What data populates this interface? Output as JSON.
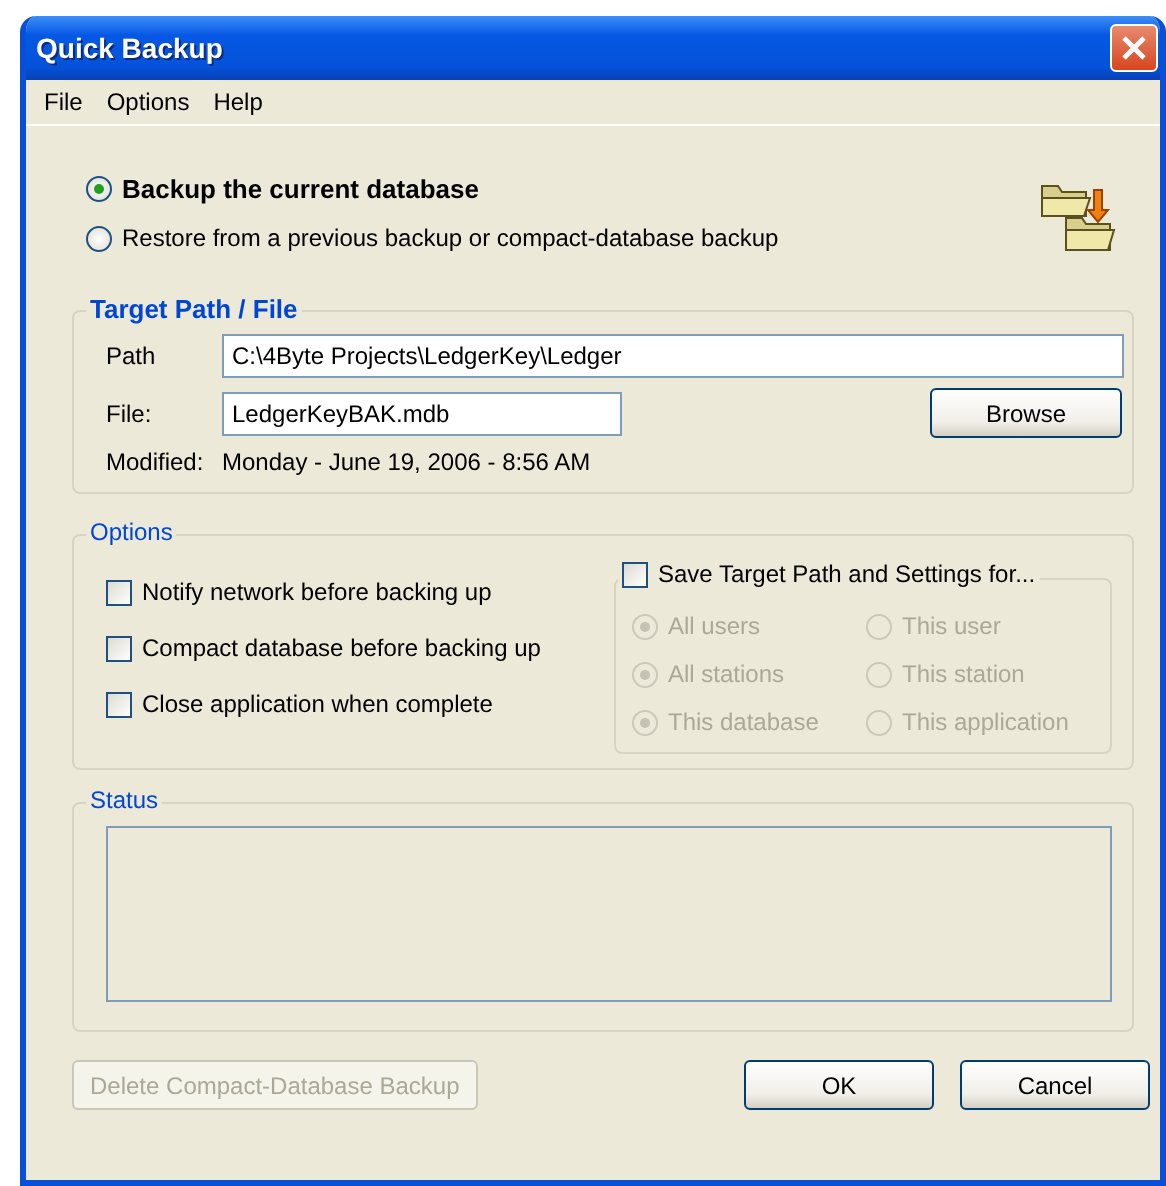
{
  "window": {
    "title": "Quick Backup"
  },
  "menu": [
    {
      "label": "File"
    },
    {
      "label": "Options"
    },
    {
      "label": "Help"
    }
  ],
  "modes": [
    {
      "label": "Backup the current database",
      "selected": true
    },
    {
      "label": "Restore from a previous backup or compact-database backup",
      "selected": false
    }
  ],
  "target": {
    "title": "Target Path / File",
    "path_label": "Path",
    "path": "C:\\4Byte Projects\\LedgerKey\\Ledger",
    "file_label": "File:",
    "file": "LedgerKeyBAK.mdb",
    "browse": "Browse",
    "modified_label": "Modified:",
    "modified": "Monday - June 19, 2006 - 8:56 AM"
  },
  "options": {
    "title": "Options",
    "checks": [
      {
        "label": "Notify network before backing up",
        "checked": false
      },
      {
        "label": "Compact database before backing up",
        "checked": false
      },
      {
        "label": "Close application when complete",
        "checked": false
      }
    ],
    "save": {
      "label": "Save Target Path and Settings for...",
      "checked": false,
      "disabled": true,
      "rows": [
        [
          {
            "label": "All users",
            "selected": true
          },
          {
            "label": "This user",
            "selected": false
          }
        ],
        [
          {
            "label": "All stations",
            "selected": true
          },
          {
            "label": "This station",
            "selected": false
          }
        ],
        [
          {
            "label": "This database",
            "selected": true
          },
          {
            "label": "This application",
            "selected": false
          }
        ]
      ]
    }
  },
  "status": {
    "title": "Status"
  },
  "buttons": [
    {
      "label": "Delete Compact-Database Backup",
      "disabled": true
    },
    {
      "label": "OK",
      "disabled": false
    },
    {
      "label": "Cancel",
      "disabled": false
    }
  ]
}
